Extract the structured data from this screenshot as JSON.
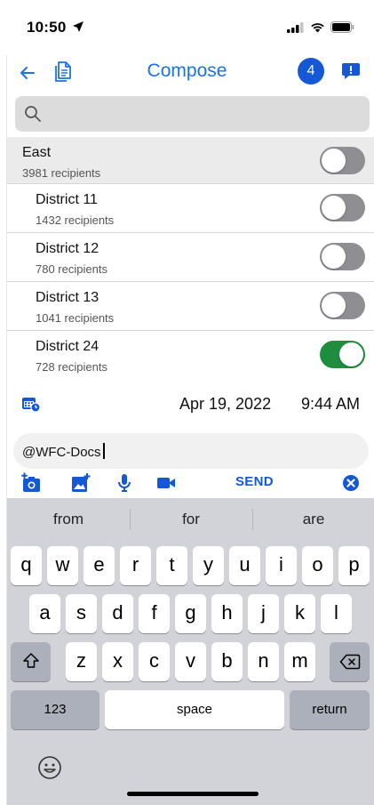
{
  "status": {
    "time": "10:50"
  },
  "nav": {
    "title": "Compose",
    "badge_count": "4"
  },
  "search": {
    "placeholder": ""
  },
  "list": {
    "group": {
      "title": "East",
      "subtitle": "3981 recipients",
      "enabled": false
    },
    "items": [
      {
        "title": "District 11",
        "subtitle": "1432 recipients",
        "enabled": false
      },
      {
        "title": "District 12",
        "subtitle": "780 recipients",
        "enabled": false
      },
      {
        "title": "District 13",
        "subtitle": "1041 recipients",
        "enabled": false
      },
      {
        "title": "District 24",
        "subtitle": "728 recipients",
        "enabled": true
      }
    ]
  },
  "schedule": {
    "date": "Apr 19, 2022",
    "time": "9:44 AM"
  },
  "compose": {
    "text": "@WFC-Docs",
    "send_label": "SEND"
  },
  "keyboard": {
    "suggestions": [
      "from",
      "for",
      "are"
    ],
    "row1": [
      "q",
      "w",
      "e",
      "r",
      "t",
      "y",
      "u",
      "i",
      "o",
      "p"
    ],
    "row2": [
      "a",
      "s",
      "d",
      "f",
      "g",
      "h",
      "j",
      "k",
      "l"
    ],
    "row3": [
      "z",
      "x",
      "c",
      "v",
      "b",
      "n",
      "m"
    ],
    "numbers_label": "123",
    "space_label": "space",
    "return_label": "return"
  },
  "colors": {
    "accent": "#1558d6",
    "toggle_on": "#1e8e3e",
    "toggle_off": "#8e8e93"
  }
}
